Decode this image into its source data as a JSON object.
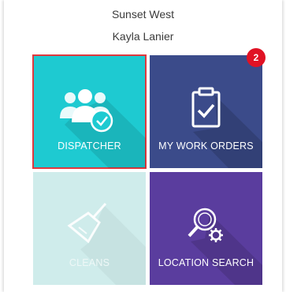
{
  "header": {
    "site": "Sunset West",
    "user": "Kayla Lanier"
  },
  "tiles": [
    {
      "label": "DISPATCHER",
      "icon": "users-check-icon",
      "color": "#1ecad1",
      "selected": true
    },
    {
      "label": "MY WORK ORDERS",
      "icon": "clipboard-check-icon",
      "color": "#3b4b8a",
      "badge": "2"
    },
    {
      "label": "CLEANS",
      "icon": "broom-icon",
      "color": "#cfeceb",
      "disabled": true
    },
    {
      "label": "LOCATION SEARCH",
      "icon": "search-gear-icon",
      "color": "#5a3d9e"
    }
  ],
  "colors": {
    "selection_border": "#e0393e",
    "badge": "#e01224"
  }
}
